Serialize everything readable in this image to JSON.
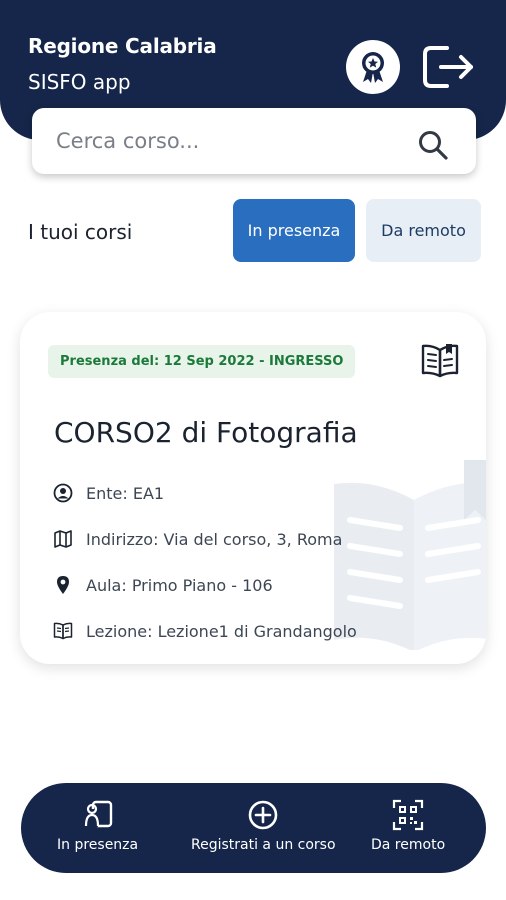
{
  "header": {
    "title": "Regione Calabria",
    "subtitle": "SISFO app",
    "badge_icon": "award-icon",
    "logout_icon": "logout-icon",
    "background": "#15264a"
  },
  "search": {
    "placeholder": "Cerca corso...",
    "icon": "search-icon"
  },
  "courses_section": {
    "title": "I tuoi corsi",
    "tabs": [
      {
        "label": "In presenza",
        "active": true
      },
      {
        "label": "Da remoto",
        "active": false
      }
    ]
  },
  "course_card": {
    "presence_label": "Presenza del: 12 Sep 2022 - INGRESSO",
    "title": "CORSO2 di Fotografia",
    "info": [
      {
        "icon": "user-circle-icon",
        "text": "Ente: EA1"
      },
      {
        "icon": "map-icon",
        "text": "Indirizzo: Via del corso, 3, Roma"
      },
      {
        "icon": "location-pin-icon",
        "text": "Aula: Primo Piano - 106"
      },
      {
        "icon": "book-icon",
        "text": "Lezione: Lezione1 di Grandangolo"
      }
    ]
  },
  "bottom_nav": {
    "items": [
      {
        "label": "In presenza",
        "icon": "person-badge-icon"
      },
      {
        "label": "Registrati a un corso",
        "icon": "plus-circle-icon"
      },
      {
        "label": "Da remoto",
        "icon": "qr-code-icon"
      }
    ]
  },
  "colors": {
    "primary_dark": "#15264a",
    "tab_active": "#2a6fbf",
    "tab_inactive": "#e7eef6",
    "presence_text": "#1b7a3a",
    "presence_bg": "#e8f4ea"
  }
}
